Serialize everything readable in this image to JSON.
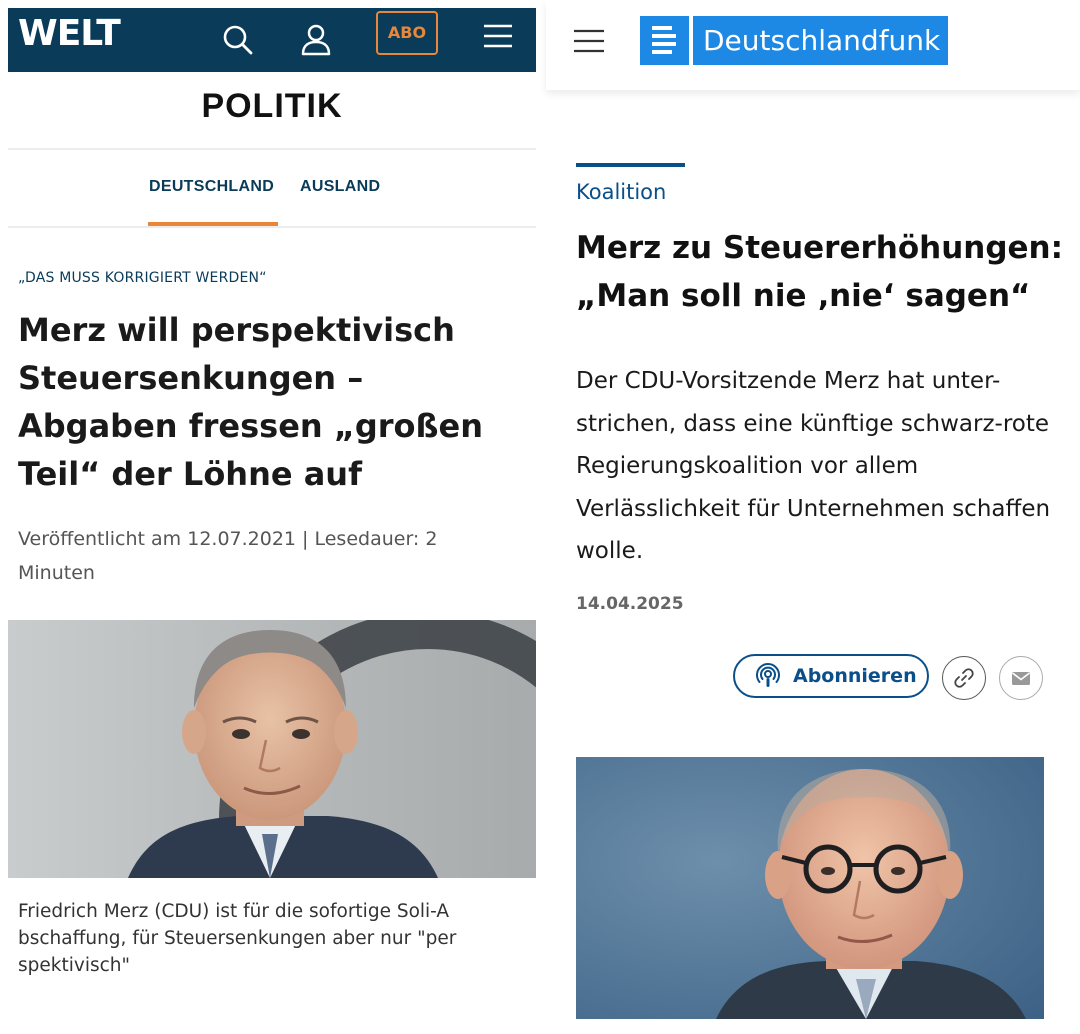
{
  "welt": {
    "logo": "WELT",
    "abo_label": "ABO",
    "section_title": "POLITIK",
    "tabs": [
      {
        "label": "DEUTSCHLAND"
      },
      {
        "label": "AUSLAND"
      }
    ],
    "kicker": "„DAS MUSS KORRIGIERT WERDEN“",
    "headline": "Merz will perspektivisch Steuersenkungen – Abgaben fressen „großen Teil“ der Löhne auf",
    "meta": "Veröffentlicht am 12.07.2021 | Lesedauer: 2 Minuten",
    "caption": "Friedrich Merz (CDU) ist für die sofortige Soli-A bschaffung, für Steuersenkungen aber nur \"per spektivisch\"",
    "colors": {
      "header": "#0a3b59",
      "accent": "#e8873a"
    },
    "icons": [
      "search-icon",
      "user-icon",
      "menu-icon"
    ]
  },
  "dlf": {
    "logo_text": "Deutschlandfunk",
    "topic": "Koalition",
    "headline": "Merz zu Steuererhöhungen: „Man soll nie ‚nie‘ sagen“",
    "teaser": "Der CDU-Vorsitzende Merz hat unter-strichen, dass eine künftige schwarz-rote Regierungskoalition vor allem Verlässlichkeit für Unternehmen schaffen wolle.",
    "date": "14.04.2025",
    "subscribe_label": "Abonnieren",
    "colors": {
      "brand": "#1e88e5",
      "accent": "#0a4f8a"
    },
    "icons": [
      "hamburger-icon",
      "podcast-icon",
      "link-icon",
      "mail-icon"
    ]
  }
}
